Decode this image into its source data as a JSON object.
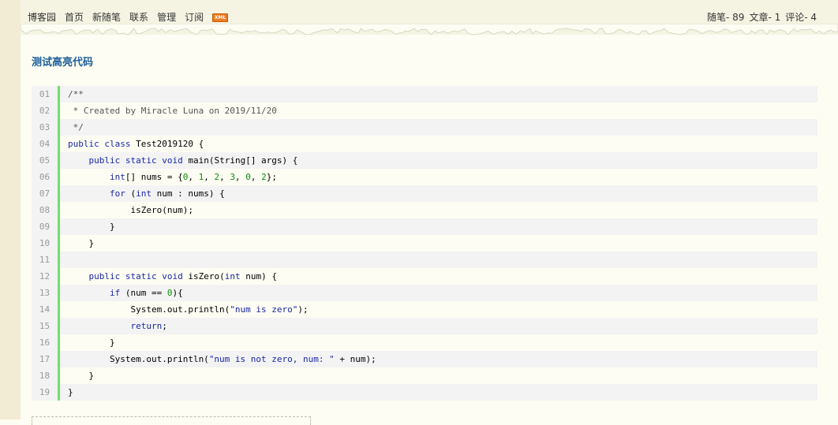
{
  "header": {
    "nav": [
      {
        "label": "博客园",
        "name": "nav-blog-home"
      },
      {
        "label": "首页",
        "name": "nav-home"
      },
      {
        "label": "新随笔",
        "name": "nav-new-post"
      },
      {
        "label": "联系",
        "name": "nav-contact"
      },
      {
        "label": "管理",
        "name": "nav-admin"
      },
      {
        "label": "订阅",
        "name": "nav-subscribe"
      }
    ],
    "rss_icon": "xml-rss-icon",
    "rss_text": "XML",
    "stats": {
      "posts": "随笔- 89",
      "articles": "文章- 1",
      "comments": "评论- 4"
    }
  },
  "post": {
    "title": "测试高亮代码"
  },
  "code": {
    "lines": [
      {
        "no": "01",
        "tokens": [
          {
            "t": "/**",
            "c": "com"
          }
        ]
      },
      {
        "no": "02",
        "tokens": [
          {
            "t": " * Created by Miracle Luna on 2019/11/20",
            "c": "com"
          }
        ]
      },
      {
        "no": "03",
        "tokens": [
          {
            "t": " */",
            "c": "com"
          }
        ]
      },
      {
        "no": "04",
        "tokens": [
          {
            "t": "public class ",
            "c": "kw"
          },
          {
            "t": "Test2019120 {",
            "c": "pl"
          }
        ]
      },
      {
        "no": "05",
        "tokens": [
          {
            "t": "    ",
            "c": "pl"
          },
          {
            "t": "public static void ",
            "c": "kw"
          },
          {
            "t": "main(String[] args) {",
            "c": "pl"
          }
        ]
      },
      {
        "no": "06",
        "tokens": [
          {
            "t": "        ",
            "c": "pl"
          },
          {
            "t": "int",
            "c": "kw"
          },
          {
            "t": "[] nums = {",
            "c": "pl"
          },
          {
            "t": "0",
            "c": "num"
          },
          {
            "t": ", ",
            "c": "pl"
          },
          {
            "t": "1",
            "c": "num"
          },
          {
            "t": ", ",
            "c": "pl"
          },
          {
            "t": "2",
            "c": "num"
          },
          {
            "t": ", ",
            "c": "pl"
          },
          {
            "t": "3",
            "c": "num"
          },
          {
            "t": ", ",
            "c": "pl"
          },
          {
            "t": "0",
            "c": "num"
          },
          {
            "t": ", ",
            "c": "pl"
          },
          {
            "t": "2",
            "c": "num"
          },
          {
            "t": "};",
            "c": "pl"
          }
        ]
      },
      {
        "no": "07",
        "tokens": [
          {
            "t": "        ",
            "c": "pl"
          },
          {
            "t": "for ",
            "c": "kw"
          },
          {
            "t": "(",
            "c": "pl"
          },
          {
            "t": "int ",
            "c": "kw"
          },
          {
            "t": "num : nums) {",
            "c": "pl"
          }
        ]
      },
      {
        "no": "08",
        "tokens": [
          {
            "t": "            isZero(num);",
            "c": "pl"
          }
        ]
      },
      {
        "no": "09",
        "tokens": [
          {
            "t": "        }",
            "c": "pl"
          }
        ]
      },
      {
        "no": "10",
        "tokens": [
          {
            "t": "    }",
            "c": "pl"
          }
        ]
      },
      {
        "no": "11",
        "tokens": [
          {
            "t": "",
            "c": "pl"
          }
        ]
      },
      {
        "no": "12",
        "tokens": [
          {
            "t": "    ",
            "c": "pl"
          },
          {
            "t": "public static void ",
            "c": "kw"
          },
          {
            "t": "isZero(",
            "c": "pl"
          },
          {
            "t": "int ",
            "c": "kw"
          },
          {
            "t": "num) {",
            "c": "pl"
          }
        ]
      },
      {
        "no": "13",
        "tokens": [
          {
            "t": "        ",
            "c": "pl"
          },
          {
            "t": "if ",
            "c": "kw"
          },
          {
            "t": "(num == ",
            "c": "pl"
          },
          {
            "t": "0",
            "c": "num"
          },
          {
            "t": "){",
            "c": "pl"
          }
        ]
      },
      {
        "no": "14",
        "tokens": [
          {
            "t": "            System.out.println(",
            "c": "pl"
          },
          {
            "t": "\"num is zero\"",
            "c": "str"
          },
          {
            "t": ");",
            "c": "pl"
          }
        ]
      },
      {
        "no": "15",
        "tokens": [
          {
            "t": "            ",
            "c": "pl"
          },
          {
            "t": "return",
            "c": "kw"
          },
          {
            "t": ";",
            "c": "pl"
          }
        ]
      },
      {
        "no": "16",
        "tokens": [
          {
            "t": "        }",
            "c": "pl"
          }
        ]
      },
      {
        "no": "17",
        "tokens": [
          {
            "t": "        System.out.println(",
            "c": "pl"
          },
          {
            "t": "\"num is not zero, num: \"",
            "c": "str"
          },
          {
            "t": " + num);",
            "c": "pl"
          }
        ]
      },
      {
        "no": "18",
        "tokens": [
          {
            "t": "    }",
            "c": "pl"
          }
        ]
      },
      {
        "no": "19",
        "tokens": [
          {
            "t": "}",
            "c": "pl"
          }
        ]
      }
    ]
  },
  "colors": {
    "page_bg": "#fdfdf3",
    "title": "#1b5e9a",
    "keyword": "#1a26a8",
    "number": "#069206",
    "gutter_bar": "#6ce26c"
  }
}
